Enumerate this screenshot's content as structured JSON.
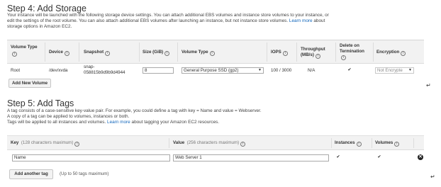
{
  "storage": {
    "title": "Step 4: Add Storage",
    "desc_line1": "Your instance will be launched with the following storage device settings. You can attach additional EBS volumes and instance store volumes to your instance, or",
    "desc_line2a": "edit the settings of the root volume. You can also attach additional EBS volumes after launching an instance, but not instance store volumes.",
    "desc_link": "Learn more",
    "desc_line2b": "about",
    "desc_line3": "storage options in Amazon EC2.",
    "headers": {
      "volume_type": "Volume Type",
      "device": "Device",
      "snapshot": "Snapshot",
      "size": "Size (GiB)",
      "volume_type2": "Volume Type",
      "iops": "IOPS",
      "throughput": "Throughput",
      "throughput_unit": "(MB/s)",
      "delete_on": "Delete on",
      "termination": "Termination",
      "encryption": "Encryption",
      "info": "i"
    },
    "row": {
      "volume_type": "Root",
      "device": "/dev/xvda",
      "snapshot_line1": "snap-",
      "snapshot_line2": "058815b9d9b9d4944",
      "size": "8",
      "ebs_type": "General Purpose SSD (gp2)",
      "iops": "100 / 3000",
      "throughput": "N/A",
      "delete_checked": "✔",
      "encryption": "Not Encrypte"
    },
    "add_volume_button": "Add New Volume"
  },
  "tags": {
    "title": "Step 5: Add Tags",
    "desc_line1": "A tag consists of a case-sensitive key-value pair. For example, you could define a tag with key = Name and value = Webserver.",
    "desc_line2": "A copy of a tag can be applied to volumes, instances or both.",
    "desc_line3a": "Tags will be applied to all instances and volumes.",
    "desc_link": "Learn more",
    "desc_line3b": "about tagging your Amazon EC2 resources.",
    "headers": {
      "key": "Key",
      "key_hint": "(128 characters maximum)",
      "value": "Value",
      "value_hint": "(256 characters maximum)",
      "instances": "Instances",
      "volumes": "Volumes",
      "info": "i"
    },
    "row": {
      "key": "Name",
      "value": "Web Server 1",
      "instances_checked": "✔",
      "volumes_checked": "✔",
      "remove": "✕"
    },
    "add_tag_button": "Add another tag",
    "add_tag_hint": "(Up to 50 tags maximum)"
  },
  "return_mark": "↵",
  "icons": [
    "info-icon",
    "chevron-down-icon",
    "checkbox-checked-icon",
    "remove-circle-icon",
    "return-arrow-icon"
  ]
}
